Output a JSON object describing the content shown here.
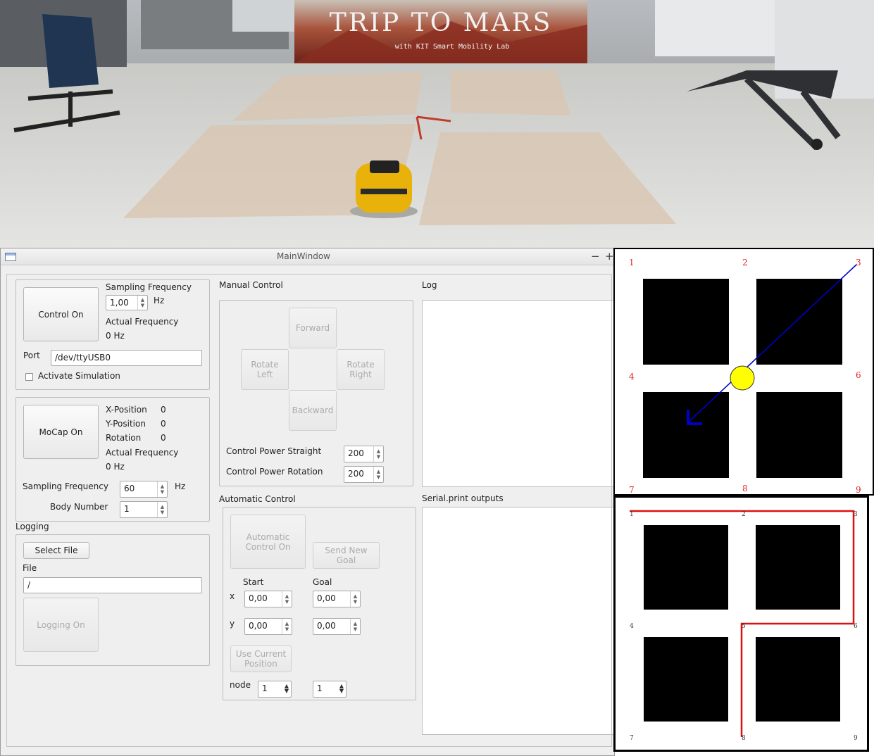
{
  "photo": {
    "banner_title": "TRIP TO MARS",
    "banner_subtitle": "with KIT Smart Mobility Lab"
  },
  "window": {
    "title": "MainWindow",
    "minimize": "−",
    "maximize": "+"
  },
  "serial_group": {
    "control_button": "Control On",
    "sampling_frequency_label": "Sampling Frequency",
    "sampling_frequency_value": "1,00",
    "sampling_frequency_unit": "Hz",
    "actual_frequency_label": "Actual Frequency",
    "actual_frequency_value": "0 Hz",
    "port_label": "Port",
    "port_value": "/dev/ttyUSB0",
    "simulation_label": "Activate Simulation"
  },
  "mocap_group": {
    "mocap_button": "MoCap On",
    "x_label": "X-Position",
    "x_value": "0",
    "y_label": "Y-Position",
    "y_value": "0",
    "rotation_label": "Rotation",
    "rotation_value": "0",
    "actual_frequency_label": "Actual Frequency",
    "actual_frequency_value": "0 Hz",
    "sampling_frequency_label": "Sampling Frequency",
    "sampling_frequency_value": "60",
    "sampling_frequency_unit": "Hz",
    "body_number_label": "Body Number",
    "body_number_value": "1"
  },
  "logging": {
    "title": "Logging",
    "select_file_button": "Select File",
    "file_label": "File",
    "file_value": "/",
    "logging_button": "Logging On"
  },
  "manual_control": {
    "title": "Manual Control",
    "forward": "Forward",
    "rotate_left_1": "Rotate",
    "rotate_left_2": "Left",
    "rotate_right_1": "Rotate",
    "rotate_right_2": "Right",
    "backward": "Backward",
    "power_straight_label": "Control Power Straight",
    "power_straight_value": "200",
    "power_rotation_label": "Control Power Rotation",
    "power_rotation_value": "200"
  },
  "automatic_control": {
    "title": "Automatic Control",
    "auto_button_1": "Automatic",
    "auto_button_2": "Control On",
    "send_goal_1": "Send New",
    "send_goal_2": "Goal",
    "start_label": "Start",
    "goal_label": "Goal",
    "x_label": "x",
    "y_label": "y",
    "start_x": "0,00",
    "start_y": "0,00",
    "goal_x": "0,00",
    "goal_y": "0,00",
    "use_current_1": "Use Current",
    "use_current_2": "Position",
    "node_label": "node",
    "start_node": "1",
    "goal_node": "1"
  },
  "log": {
    "title": "Log"
  },
  "serial_output": {
    "title": "Serial.print outputs"
  },
  "map_top": {
    "nodes": [
      "1",
      "2",
      "3",
      "4",
      "6",
      "7",
      "8",
      "9"
    ],
    "robot_color": "#ffff00",
    "heading_color": "#0000c8"
  },
  "map_bottom": {
    "nodes": [
      "1",
      "2",
      "3",
      "4",
      "5",
      "6",
      "7",
      "8",
      "9"
    ],
    "path_color": "#e01010",
    "path_nodes": [
      "8",
      "5",
      "6",
      "3",
      "2",
      "1"
    ]
  }
}
